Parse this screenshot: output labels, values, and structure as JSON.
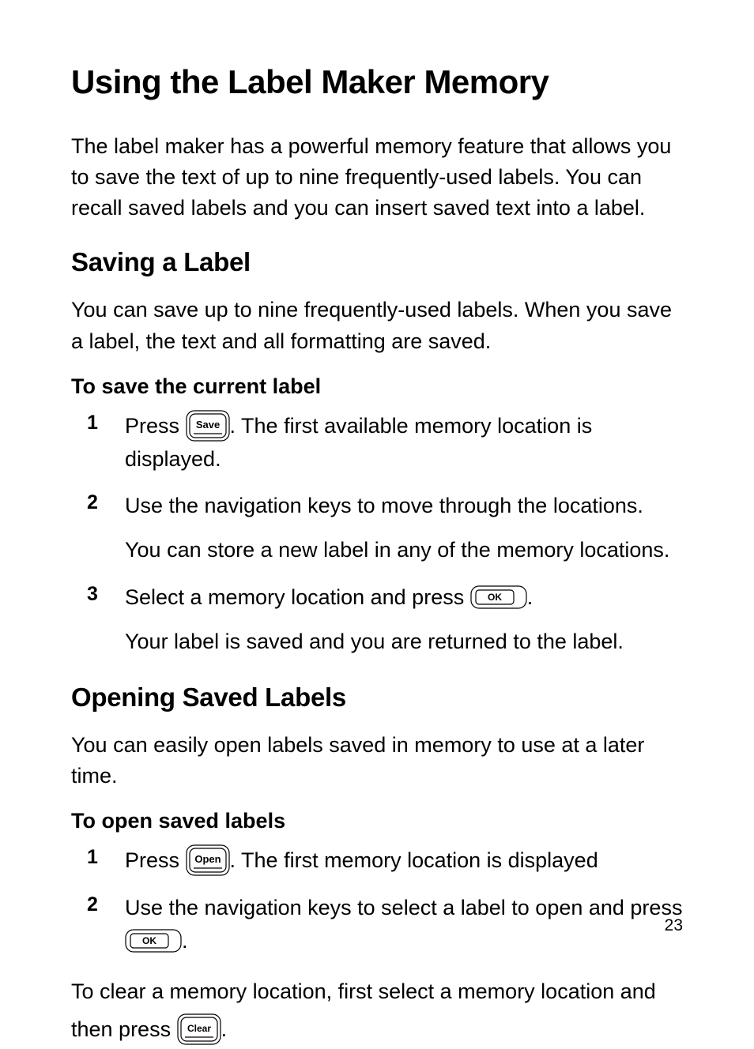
{
  "page_number": "23",
  "h1": "Using the Label Maker Memory",
  "intro": "The label maker has a powerful memory feature that allows you to save the text of up to nine frequently-used labels. You can recall saved labels and you can insert saved text into a label.",
  "sec1": {
    "title": "Saving a Label",
    "intro": "You can save up to nine frequently-used labels. When you save a label, the text and all formatting are saved.",
    "task_title": "To save the current label",
    "steps": [
      {
        "n": "1",
        "pre": "Press ",
        "key": "Save",
        "post": ". The first available memory location is displayed."
      },
      {
        "n": "2",
        "text1": "Use the navigation keys to move through the locations.",
        "text2": "You can store a new label in any of the memory locations."
      },
      {
        "n": "3",
        "pre": "Select a memory location and press ",
        "key": "OK",
        "post": ".",
        "text2": "Your label is saved and you are returned to the label."
      }
    ]
  },
  "sec2": {
    "title": "Opening Saved Labels",
    "intro": "You can easily open labels saved in memory to use at a later time.",
    "task_title": "To open saved labels",
    "steps": [
      {
        "n": "1",
        "pre": "Press ",
        "key": "Open",
        "post": ". The first memory location is displayed"
      },
      {
        "n": "2",
        "pre": "Use the navigation keys to select a label to open and press ",
        "key": "OK",
        "post": "."
      }
    ],
    "clear_pre": "To clear a memory location, first select a memory location and then press ",
    "clear_key": "Clear",
    "clear_post": "."
  }
}
